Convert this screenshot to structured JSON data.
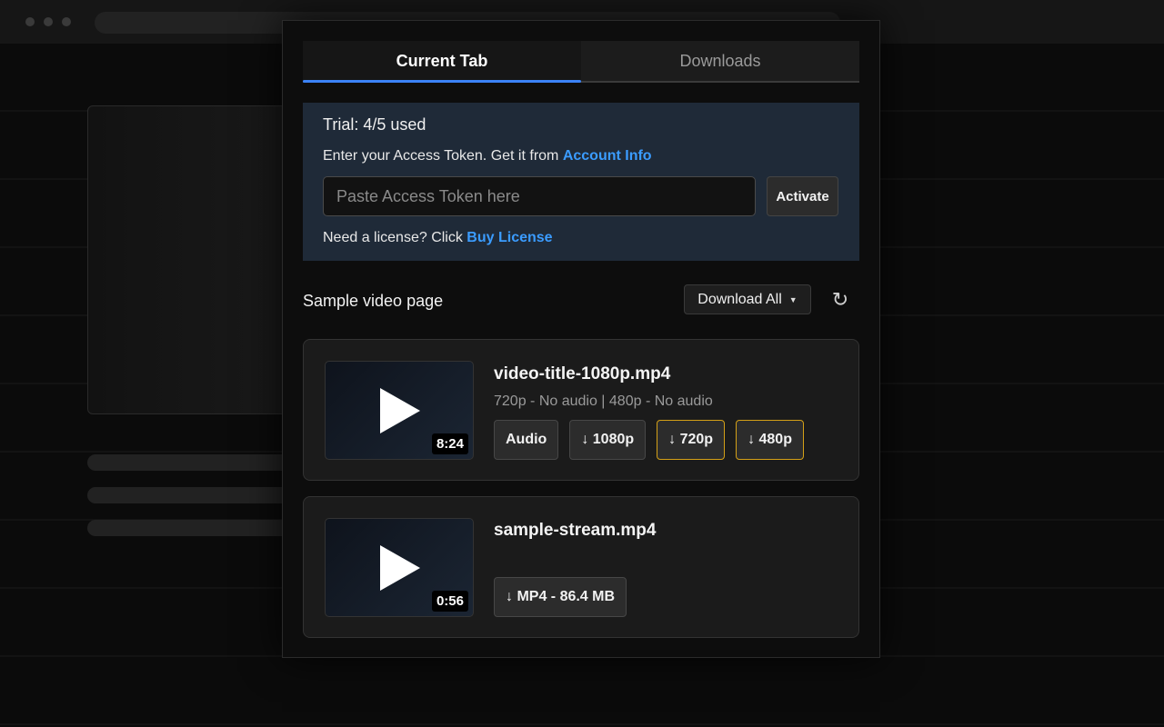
{
  "tabs": [
    {
      "label": "Current Tab",
      "active": true
    },
    {
      "label": "Downloads",
      "active": false
    }
  ],
  "license": {
    "trial_text": "Trial: 4/5 used",
    "token_help_prefix": "Enter your Access Token. Get it from ",
    "token_help_link": "Account Info",
    "token_placeholder": "Paste Access Token here",
    "token_value": "",
    "activate_label": "Activate",
    "need_prefix": "Need a license? Click ",
    "need_link": "Buy License"
  },
  "page": {
    "title": "Sample video page",
    "download_all_label": "Download All",
    "refresh_glyph": "↻"
  },
  "videos": [
    {
      "filename": "video-title-1080p.mp4",
      "duration": "8:24",
      "meta": "720p - No audio | 480p - No audio",
      "formats": [
        "Audio",
        "↓ 1080p",
        "↓ 720p",
        "↓ 480p"
      ]
    },
    {
      "filename": "sample-stream.mp4",
      "duration": "0:56",
      "meta": "",
      "formats": [
        "↓ MP4 - 86.4 MB"
      ]
    }
  ],
  "colors": {
    "accent": "#3b82f6",
    "link": "#3b9cff",
    "highlight_border": "#d4a017",
    "license_panel_bg": "#1f2a38"
  },
  "icons": [
    "play-icon",
    "caret-down-icon",
    "refresh-icon"
  ]
}
